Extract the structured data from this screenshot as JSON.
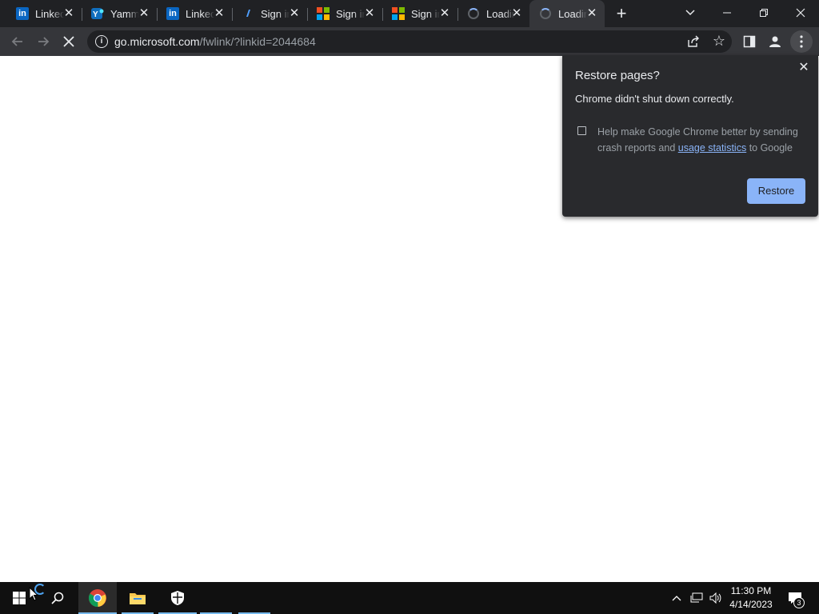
{
  "tabs": [
    {
      "title": "LinkedIn",
      "favicon": "linkedin-icon",
      "state": "inactive"
    },
    {
      "title": "Yammer",
      "favicon": "yammer-icon",
      "state": "inactive"
    },
    {
      "title": "LinkedIn",
      "favicon": "linkedin-icon",
      "state": "inactive"
    },
    {
      "title": "Sign in",
      "favicon": "yammer-icon",
      "state": "inactive"
    },
    {
      "title": "Sign in",
      "favicon": "microsoft-icon",
      "state": "inactive"
    },
    {
      "title": "Sign in",
      "favicon": "microsoft-icon",
      "state": "inactive"
    },
    {
      "title": "Loading",
      "favicon": "loading-spinner-icon",
      "state": "inactive"
    },
    {
      "title": "Loading",
      "favicon": "loading-spinner-icon",
      "state": "active"
    }
  ],
  "toolbar": {
    "url_host": "go.microsoft.com",
    "url_path": "/fwlink/?linkid=2044684"
  },
  "restore_bubble": {
    "title": "Restore pages?",
    "message": "Chrome didn't shut down correctly.",
    "checkbox_text_before": "Help make Google Chrome better by sending crash reports and ",
    "checkbox_link": "usage statistics",
    "checkbox_text_after": " to Google",
    "checkbox_checked": false,
    "restore_button": "Restore"
  },
  "taskbar": {
    "time": "11:30 PM",
    "date": "4/14/2023",
    "notification_count": "3"
  },
  "colors": {
    "chrome_dark": "#202124",
    "toolbar": "#35363a",
    "accent": "#8ab4f8",
    "linkedin": "#0a66c2",
    "taskbar": "#101010"
  }
}
